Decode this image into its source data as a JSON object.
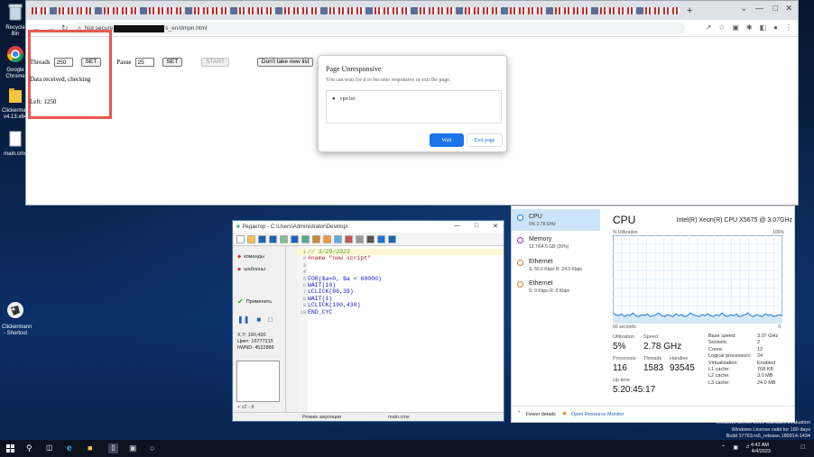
{
  "desktop": {
    "icons": [
      {
        "label": "Recycle Bin"
      },
      {
        "label": "Google Chrome"
      },
      {
        "label": "Clickermann v4.13.x64"
      },
      {
        "label": "main.cms"
      },
      {
        "label": "Clickermann - Shortcut"
      }
    ]
  },
  "browser": {
    "url_prefix": "Not secure",
    "url_suffix": "s_en/dmpn.html",
    "new_tab": "+",
    "page": {
      "threads_label": "Threads",
      "threads_value": "250",
      "set_label": "SET",
      "pause_label": "Pause",
      "pause_value": "25",
      "start_label": "START",
      "dont_take_label": "Don't take new list",
      "status_text": "Data received, checking",
      "left_text": "Left: 1250"
    },
    "dialog": {
      "title": "Page Unresponsive",
      "description": "You can wait for it to become responsive or exit the page.",
      "item": "vpn brt",
      "wait_label": "Wait",
      "exit_label": "Exit page"
    }
  },
  "editor": {
    "title": "Редактор - C:\\Users\\Administrator\\Desktop\\",
    "left_items": [
      {
        "label": "команды"
      },
      {
        "label": "шаблоны"
      },
      {
        "label": "Применить"
      }
    ],
    "coords": {
      "xy": "X,Y:    190,430",
      "color": "Цвет: 16777215",
      "hwnd": "hWND: 4522886"
    },
    "zoom_row": "+   x2  -   8",
    "code": [
      {
        "n": "1",
        "t": "// 3/29/2023",
        "k": "comment"
      },
      {
        "n": "2",
        "t": "#name \"new script\"",
        "k": "name"
      },
      {
        "n": "3",
        "t": "",
        "k": ""
      },
      {
        "n": "4",
        "t": "",
        "k": ""
      },
      {
        "n": "5",
        "t": "FOR($a=0, $a < 60000)",
        "k": ""
      },
      {
        "n": "6",
        "t": "WAIT(10)",
        "k": ""
      },
      {
        "n": "7",
        "t": "LCLICK(86,39)",
        "k": ""
      },
      {
        "n": "8",
        "t": "WAIT(1)",
        "k": ""
      },
      {
        "n": "9",
        "t": "LCLICK(190,430)",
        "k": ""
      },
      {
        "n": "10",
        "t": "END_CYC",
        "k": ""
      }
    ],
    "status_mode": "Режим эмуляции",
    "status_file": "main.cms"
  },
  "taskmgr": {
    "resources": [
      {
        "name": "CPU",
        "sub": "5% 2.78 GHz"
      },
      {
        "name": "Memory",
        "sub": "12.7/64.0 GB (20%)"
      },
      {
        "name": "Ethernet",
        "sub": "S: 56.0 Kbps R: 24.0 Kbps"
      },
      {
        "name": "Ethernet",
        "sub": "S: 0 Kbps R: 0 Kbps"
      }
    ],
    "title": "CPU",
    "cpu_name": "Intel(R) Xeon(R) CPU X5675 @ 3.07GHz",
    "util_label": "% Utilization",
    "util_max": "100%",
    "secs_label": "60 seconds",
    "zero_label": "0",
    "stats": {
      "utilization_label": "Utilization",
      "utilization": "5%",
      "speed_label": "Speed",
      "speed": "2.78 GHz",
      "processes_label": "Processes",
      "processes": "116",
      "threads_label": "Threads",
      "threads": "1583",
      "handles_label": "Handles",
      "handles": "93545",
      "uptime_label": "Up time",
      "uptime": "5:20:45:17"
    },
    "details": [
      {
        "k": "Base speed:",
        "v": "3.07 GHz"
      },
      {
        "k": "Sockets:",
        "v": "2"
      },
      {
        "k": "Cores:",
        "v": "12"
      },
      {
        "k": "Logical processors:",
        "v": "24"
      },
      {
        "k": "Virtualization:",
        "v": "Enabled"
      },
      {
        "k": "L1 cache:",
        "v": "768 KB"
      },
      {
        "k": "L2 cache:",
        "v": "3.0 MB"
      },
      {
        "k": "L3 cache:",
        "v": "24.0 MB"
      }
    ],
    "footer_fewer": "Fewer details",
    "footer_monitor": "Open Resource Monitor",
    "cpu_history": [
      12,
      10,
      9,
      11,
      8,
      10,
      9,
      12,
      9,
      8,
      10,
      9,
      11,
      8,
      9,
      10,
      12,
      9,
      8,
      10,
      9,
      8,
      11,
      9,
      10,
      8,
      9,
      12,
      10,
      9,
      8,
      10,
      9,
      11,
      9,
      8,
      10,
      9,
      12,
      9,
      8,
      10,
      9,
      11,
      8,
      9,
      10,
      12,
      9,
      8,
      10,
      9,
      8,
      11,
      9,
      10,
      8,
      9,
      10,
      9
    ]
  },
  "watermark": {
    "line1": "Windows Server 2019 Standard Evaluation",
    "line2": "Windows License valid for 180 days",
    "line3": "Build 17763.rs5_release.180914-1434"
  },
  "clock": {
    "time": "4:42 AM",
    "date": "4/4/2023"
  }
}
